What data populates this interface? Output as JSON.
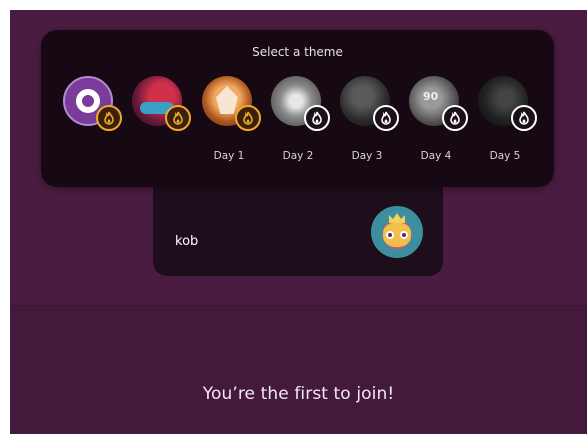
{
  "theme_picker": {
    "title": "Select a theme",
    "themes": [
      {
        "name": "default-theme",
        "day": "",
        "badge": "gold"
      },
      {
        "name": "car-theme",
        "day": "",
        "badge": "gold"
      },
      {
        "name": "fox-theme",
        "day": "Day 1",
        "badge": "gold"
      },
      {
        "name": "day2-theme",
        "day": "Day 2",
        "badge": "white"
      },
      {
        "name": "day3-theme",
        "day": "Day 3",
        "badge": "white"
      },
      {
        "name": "day4-theme",
        "day": "Day 4",
        "badge": "white",
        "artwork_number": "90"
      },
      {
        "name": "day5-theme",
        "day": "Day 5",
        "badge": "white"
      }
    ],
    "badge_icon": "flame-icon",
    "colors": {
      "badge_gold": "#f0a830",
      "panel_bg": "#170913"
    }
  },
  "player": {
    "name": "kob",
    "avatar_icon": "monster-avatar"
  },
  "status": {
    "message": "You’re the first to join!"
  },
  "colors": {
    "background": "#4a1c42",
    "card": "#1e0d1b"
  }
}
